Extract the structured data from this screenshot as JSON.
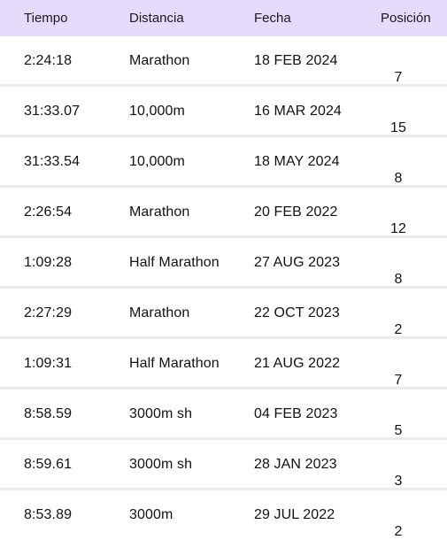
{
  "table": {
    "columns": [
      "Tiempo",
      "Distancia",
      "Fecha",
      "Posición"
    ],
    "rows": [
      {
        "tiempo": "2:24:18",
        "distancia": "Marathon",
        "fecha": "18 FEB 2024",
        "posicion": "7"
      },
      {
        "tiempo": "31:33.07",
        "distancia": "10,000m",
        "fecha": "16 MAR 2024",
        "posicion": "15"
      },
      {
        "tiempo": "31:33.54",
        "distancia": "10,000m",
        "fecha": "18 MAY 2024",
        "posicion": "8"
      },
      {
        "tiempo": "2:26:54",
        "distancia": "Marathon",
        "fecha": "20 FEB 2022",
        "posicion": "12"
      },
      {
        "tiempo": "1:09:28",
        "distancia": "Half Marathon",
        "fecha": "27 AUG 2023",
        "posicion": "8"
      },
      {
        "tiempo": "2:27:29",
        "distancia": "Marathon",
        "fecha": "22 OCT 2023",
        "posicion": "2"
      },
      {
        "tiempo": "1:09:31",
        "distancia": "Half Marathon",
        "fecha": "21 AUG 2022",
        "posicion": "7"
      },
      {
        "tiempo": "8:58.59",
        "distancia": "3000m sh",
        "fecha": "04 FEB 2023",
        "posicion": "5"
      },
      {
        "tiempo": "8:59.61",
        "distancia": "3000m sh",
        "fecha": "28 JAN 2023",
        "posicion": "3"
      },
      {
        "tiempo": "8:53.89",
        "distancia": "3000m",
        "fecha": "29 JUL 2022",
        "posicion": "2"
      }
    ]
  },
  "colors": {
    "header_background": "#e5dcfb",
    "row_separator": "#ececec"
  }
}
